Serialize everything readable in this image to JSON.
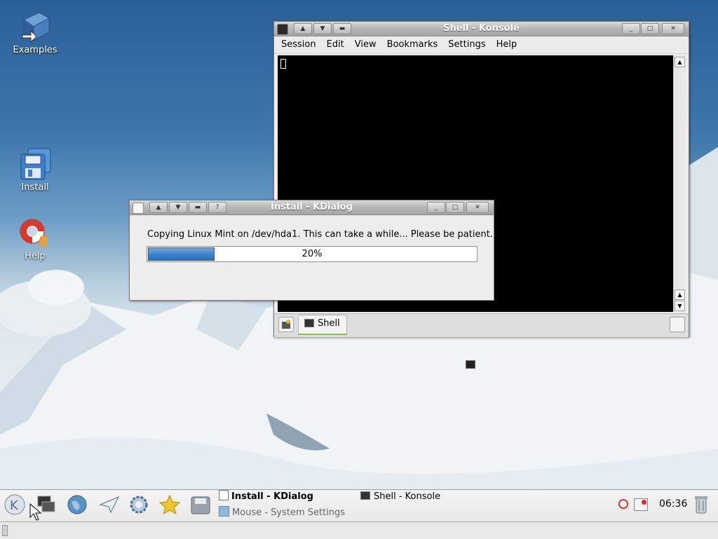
{
  "desktop": {
    "icons": [
      {
        "label": "Examples"
      },
      {
        "label": "Install"
      },
      {
        "label": "Help"
      }
    ]
  },
  "konsole": {
    "title": "Shell - Konsole",
    "menu": [
      "Session",
      "Edit",
      "View",
      "Bookmarks",
      "Settings",
      "Help"
    ],
    "tab_label": "Shell"
  },
  "dialog": {
    "title": "Install - KDialog",
    "message": "Copying Linux Mint on /dev/hda1. This can take a while... Please be patient.",
    "progress_percent": 20,
    "progress_label": "20%"
  },
  "taskbar": {
    "tasks": [
      {
        "label": "Install - KDialog",
        "active": true
      },
      {
        "label": "Shell - Konsole",
        "active": false
      },
      {
        "label": "Mouse - System Settings",
        "active": false
      }
    ],
    "clock": "06:36"
  },
  "colors": {
    "progress_fill": "#3b82cf",
    "terminal_bg": "#000000",
    "active_tab_underline": "#8ac14b"
  }
}
